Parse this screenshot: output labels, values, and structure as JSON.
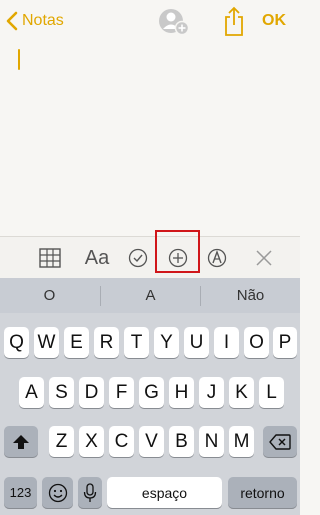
{
  "nav": {
    "back_label": "Notas",
    "ok_label": "OK",
    "accent_color": "#e1a700"
  },
  "toolbar": {
    "items": [
      "table-icon",
      "text-style-icon",
      "checklist-icon",
      "add-icon",
      "markup-icon",
      "close-icon"
    ],
    "text_style_label": "Aa",
    "highlighted_item": "add-icon",
    "highlight_color": "#d0161a"
  },
  "suggestions": [
    "O",
    "A",
    "Não"
  ],
  "keyboard": {
    "row1": [
      "Q",
      "W",
      "E",
      "R",
      "T",
      "Y",
      "U",
      "I",
      "O",
      "P"
    ],
    "row2": [
      "A",
      "S",
      "D",
      "F",
      "G",
      "H",
      "J",
      "K",
      "L"
    ],
    "row3": [
      "Z",
      "X",
      "C",
      "V",
      "B",
      "N",
      "M"
    ],
    "numbers_label": "123",
    "space_label": "espaço",
    "return_label": "retorno"
  }
}
